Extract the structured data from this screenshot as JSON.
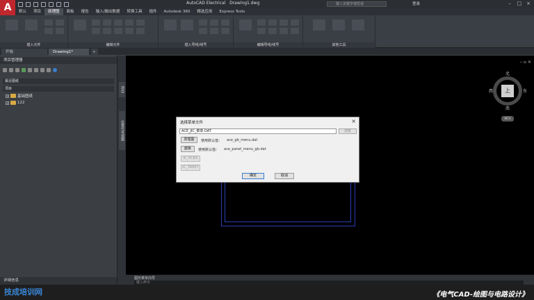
{
  "window": {
    "title": "AutoCAD Electrical",
    "doc_name": "Drawing1.dwg",
    "search_placeholder": "键入关键字或短语",
    "signin": "登录"
  },
  "ribbon": {
    "tabs": [
      "默认",
      "项目",
      "原理图",
      "面板",
      "报告",
      "输入/输出数据",
      "转换工具",
      "插件",
      "Autodesk 360",
      "精选应用",
      "Express Tools"
    ],
    "active_tab_index": 2,
    "panels": [
      "插入元件",
      "编辑元件",
      "插入导线/线号",
      "编辑导线/线号",
      "其他工具"
    ]
  },
  "doc_tabs": [
    "开始",
    "Drawing1*"
  ],
  "project_manager": {
    "header": "项目管理器",
    "section_recent": "最近图纸",
    "section_project": "项目",
    "items": [
      "基础图纸",
      "122"
    ],
    "details": "详细信息"
  },
  "side_tabs": [
    "项目",
    "位置代号视图"
  ],
  "viewcube": {
    "north": "北",
    "south": "南",
    "east": "东",
    "west": "西",
    "face": "上",
    "wcs": "WCS"
  },
  "dialog": {
    "title": "选择菜单文件",
    "path_value": "ACE_JIC_菜单.DAT",
    "browse": "浏览",
    "btn1": "原理图",
    "label1": "使用默认值：",
    "value1": "ace_gb_menu.dat",
    "btn2": "面板",
    "label2": "使用默认值：",
    "value2": "ace_panel_menu_gb.dat",
    "btn3": "IC_PCB3",
    "btn4": "IC_TREE7",
    "ok": "确定",
    "cancel": "取消"
  },
  "command": {
    "history": "图形菜单向导",
    "input_placeholder": "键入命令"
  },
  "brand": "技成培训网",
  "course_title": "《电气CAD-绘图与电路设计》"
}
